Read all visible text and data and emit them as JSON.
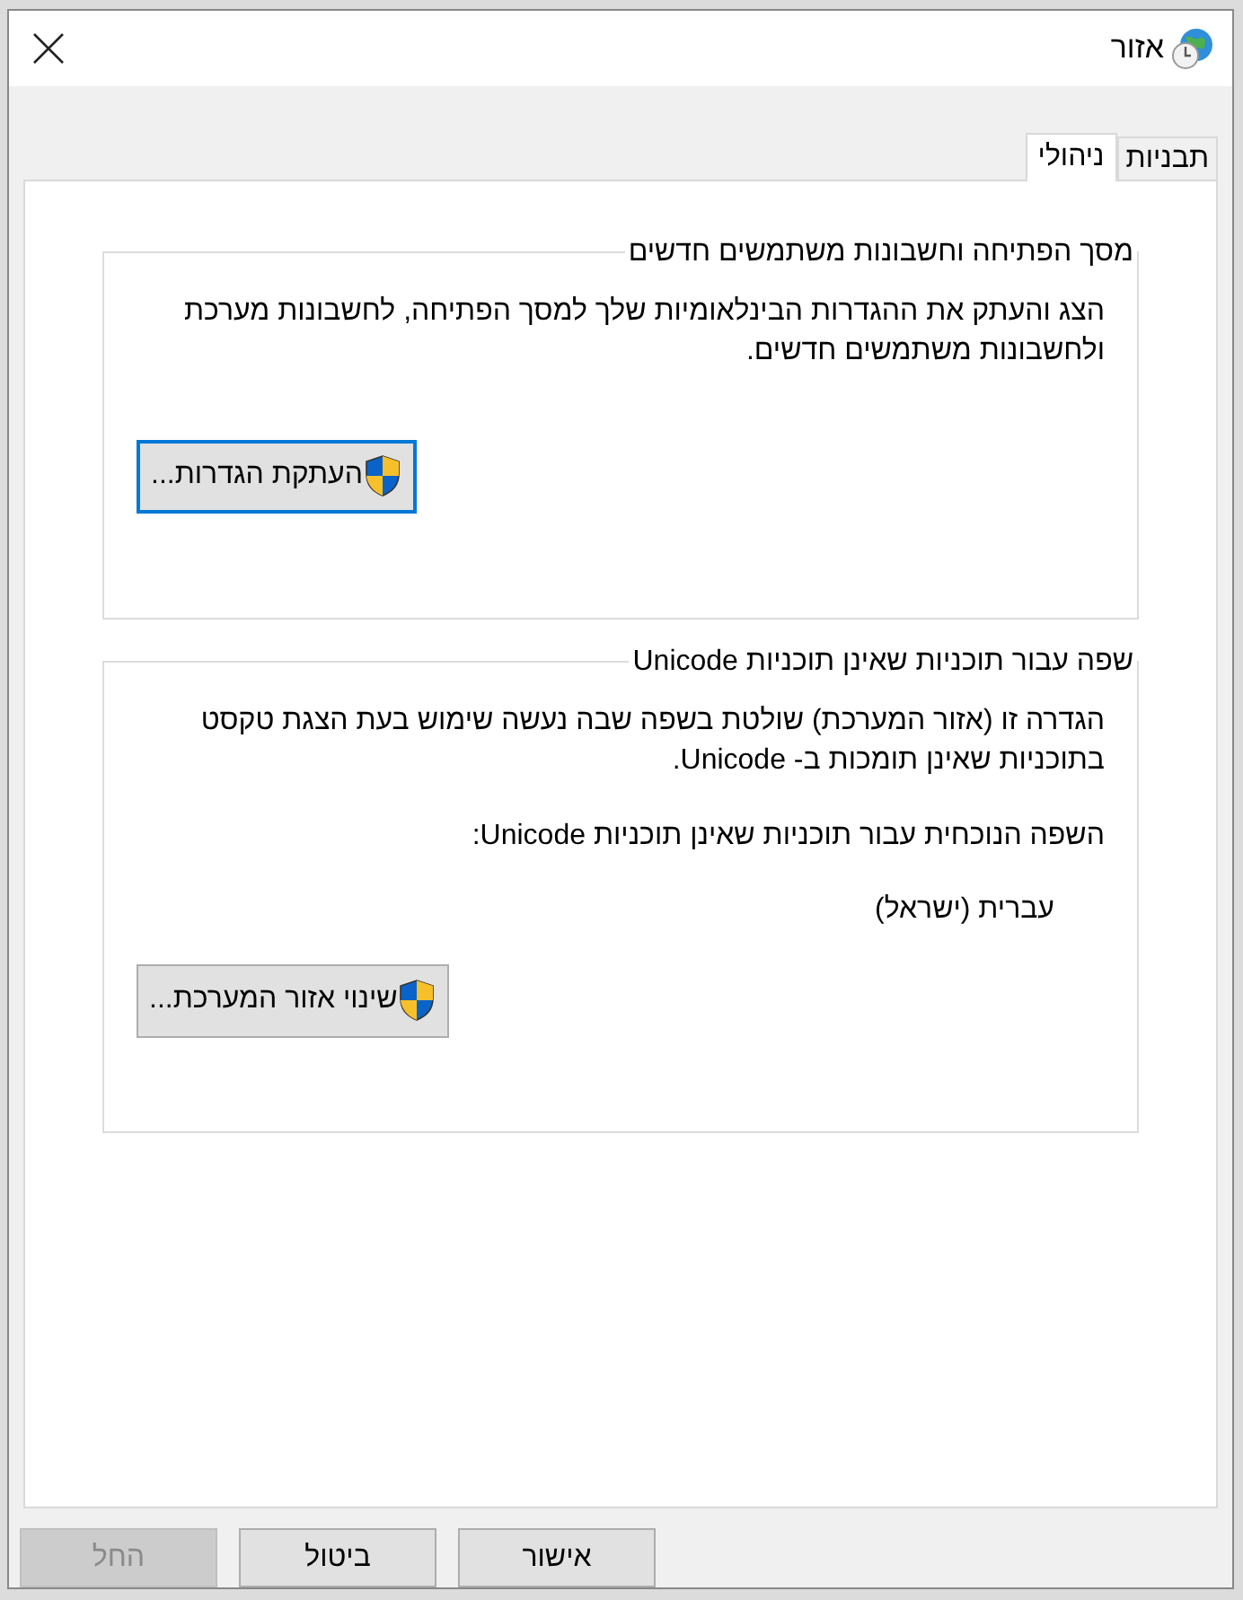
{
  "window": {
    "title": "אזור"
  },
  "tabs": [
    {
      "label": "תבניות",
      "selected": false
    },
    {
      "label": "ניהולי",
      "selected": true
    }
  ],
  "groups": [
    {
      "title": "מסך הפתיחה וחשבונות משתמשים חדשים",
      "paragraphs": [
        "הצג והעתק את ההגדרות הבינלאומיות שלך למסך הפתיחה, לחשבונות מערכת ולחשבונות משתמשים חדשים."
      ],
      "button": {
        "label": "העתקת הגדרות...",
        "focused": true
      }
    },
    {
      "title": "שפה עבור תוכניות שאינן תוכניות Unicode",
      "paragraphs": [
        "הגדרה זו (אזור המערכת) שולטת בשפה שבה נעשה שימוש בעת הצגת טקסט בתוכניות שאינן תומכות ב- Unicode.",
        "השפה הנוכחית עבור תוכניות שאינן תוכניות Unicode:"
      ],
      "value": "עברית (ישראל)",
      "button": {
        "label": "שינוי אזור המערכת...",
        "focused": false
      }
    }
  ],
  "buttons": [
    {
      "label": "אישור",
      "disabled": false
    },
    {
      "label": "ביטול",
      "disabled": false
    },
    {
      "label": "החל",
      "disabled": true
    }
  ]
}
